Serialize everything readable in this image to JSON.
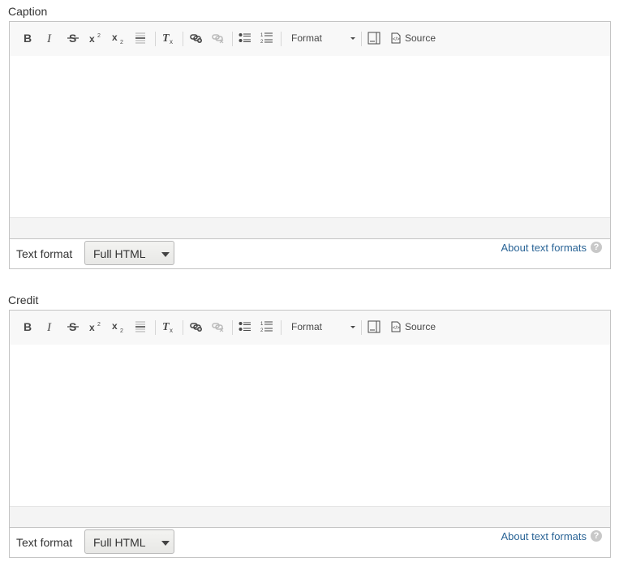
{
  "fields": [
    {
      "label": "Caption",
      "toolbar": {
        "format_label": "Format",
        "source_label": "Source",
        "icons": [
          "bold-icon",
          "italic-icon",
          "strikethrough-icon",
          "superscript-icon",
          "subscript-icon",
          "horizontal-rule-icon",
          "remove-format-icon",
          "link-icon",
          "unlink-icon",
          "bulleted-list-icon",
          "numbered-list-icon",
          "maximize-icon",
          "source-icon"
        ]
      },
      "text_format_label": "Text format",
      "text_format_value": "Full HTML",
      "about_link": "About text formats",
      "help_glyph": "?"
    },
    {
      "label": "Credit",
      "toolbar": {
        "format_label": "Format",
        "source_label": "Source",
        "icons": [
          "bold-icon",
          "italic-icon",
          "strikethrough-icon",
          "superscript-icon",
          "subscript-icon",
          "horizontal-rule-icon",
          "remove-format-icon",
          "link-icon",
          "unlink-icon",
          "bulleted-list-icon",
          "numbered-list-icon",
          "maximize-icon",
          "source-icon"
        ]
      },
      "text_format_label": "Text format",
      "text_format_value": "Full HTML",
      "about_link": "About text formats",
      "help_glyph": "?"
    }
  ],
  "colors": {
    "link": "#2a6496",
    "toolbar_bg": "#f8f8f8",
    "border": "#c4c4c4"
  }
}
